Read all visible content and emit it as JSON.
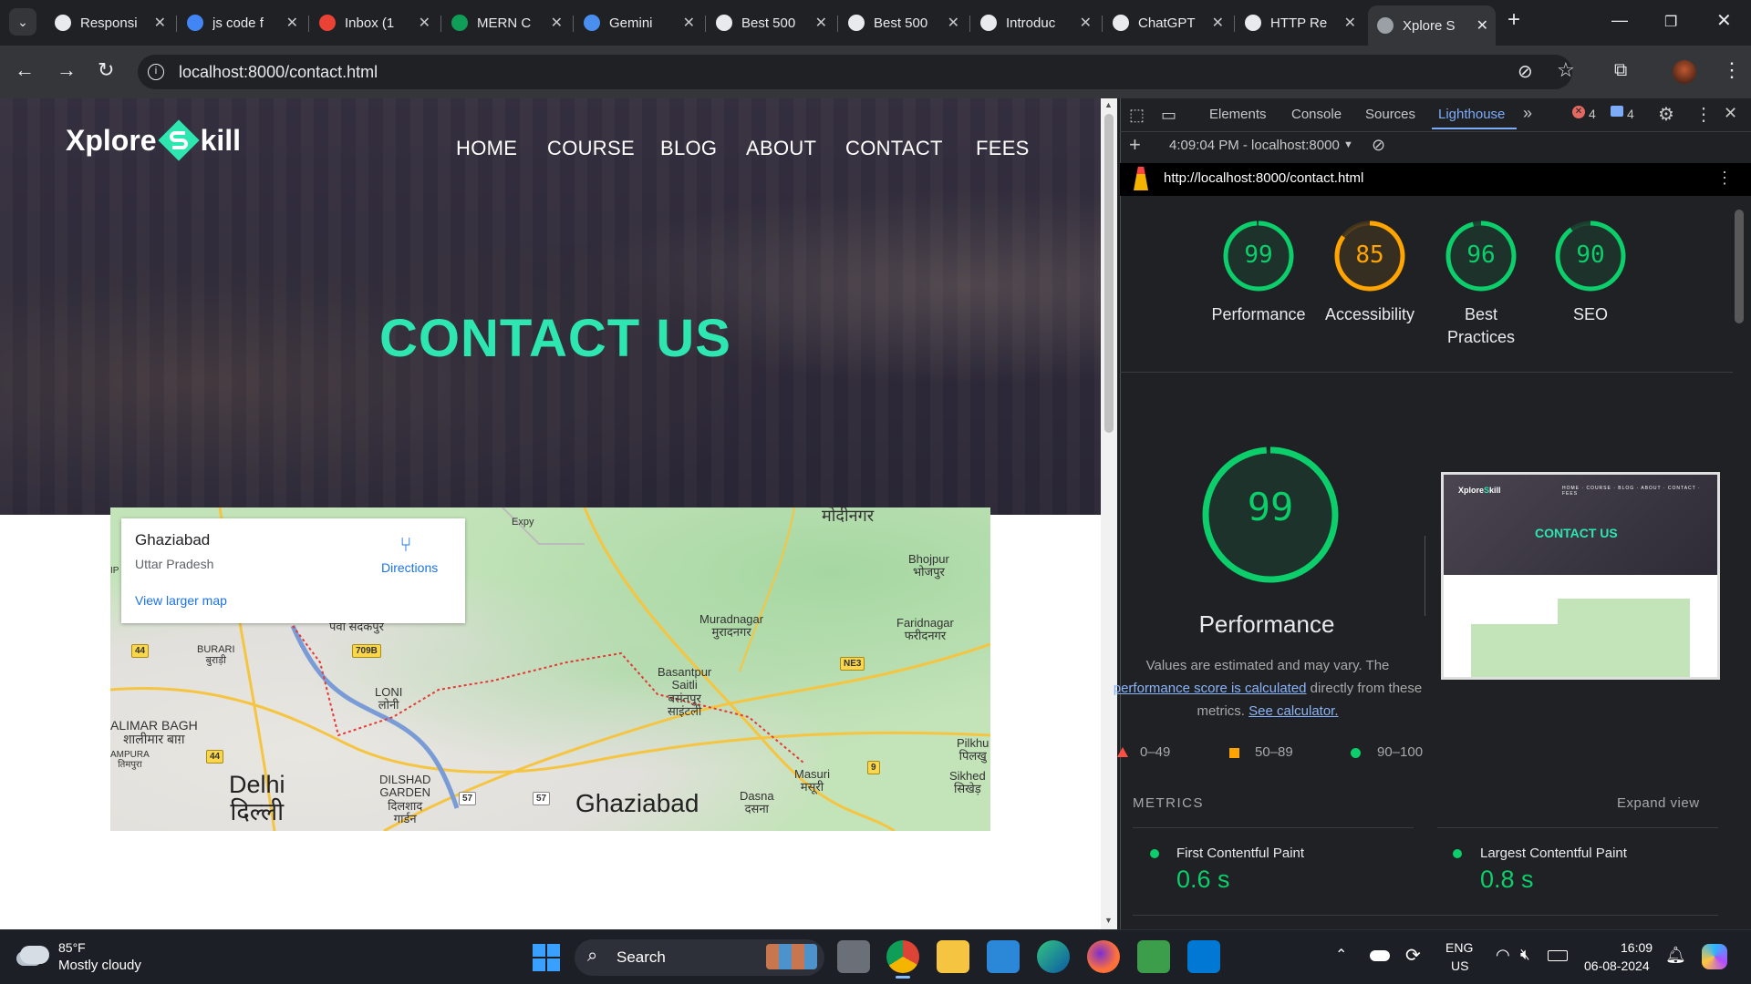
{
  "browser": {
    "tabs": [
      {
        "title": "Responsi",
        "icon": "chatgpt-icon"
      },
      {
        "title": "js code f",
        "icon": "google-icon"
      },
      {
        "title": "Inbox (1",
        "icon": "gmail-icon"
      },
      {
        "title": "MERN C",
        "icon": "sheets-icon"
      },
      {
        "title": "Gemini",
        "icon": "gemini-icon"
      },
      {
        "title": "Best 500",
        "icon": "bookmark-icon"
      },
      {
        "title": "Best 500",
        "icon": "bookmark-icon"
      },
      {
        "title": "Introduc",
        "icon": "github-icon"
      },
      {
        "title": "ChatGPT",
        "icon": "chatgpt-icon"
      },
      {
        "title": "HTTP Re",
        "icon": "chatgpt-icon"
      },
      {
        "title": "Xplore S",
        "icon": "globe-icon",
        "active": true
      }
    ],
    "new_tab": "+",
    "url": "localhost:8000/contact.html"
  },
  "site": {
    "logo_left": "Xplore",
    "logo_right": "kill",
    "nav": [
      "HOME",
      "COURSE",
      "BLOG",
      "ABOUT",
      "CONTACT",
      "FEES"
    ],
    "hero_title": "CONTACT US",
    "accent_color": "#2ee6b0"
  },
  "map": {
    "place": "Ghaziabad",
    "region": "Uttar Pradesh",
    "directions": "Directions",
    "larger_map": "View larger map",
    "labels": [
      {
        "text": "मोदीनगर",
        "name": "map-label-modinagar"
      },
      {
        "text": "Bhojpur\nभोजपुर",
        "name": "map-label-bhojpur"
      },
      {
        "text": "Muradnagar\nमुरादनगर",
        "name": "map-label-muradnagar"
      },
      {
        "text": "Faridnagar\nफरीदनगर",
        "name": "map-label-faridnagar"
      },
      {
        "text": "पवा सदकपुर",
        "name": "map-label-pava"
      },
      {
        "text": "BURARI\nबुराड़ी",
        "name": "map-label-burari"
      },
      {
        "text": "Basantpur\nSaitli\nबसंतपुर\nसाइंटली",
        "name": "map-label-basantpur"
      },
      {
        "text": "LONI\nलोनी",
        "name": "map-label-loni"
      },
      {
        "text": "ALIMAR BAGH\nशालीमार बाग़",
        "name": "map-label-shalimar"
      },
      {
        "text": "AMPURA\nतिमपुरा",
        "name": "map-label-ampura"
      },
      {
        "text": "DILSHAD\nGARDEN\nदिलशाद\nगार्डन",
        "name": "map-label-dilshad"
      },
      {
        "text": "Pilkhu\nपिलखु",
        "name": "map-label-pilkhu"
      },
      {
        "text": "Masuri\nमसूरी",
        "name": "map-label-masuri"
      },
      {
        "text": "Sikhed\nसिखेड़",
        "name": "map-label-sikhed"
      },
      {
        "text": "Dasna\nदसना",
        "name": "map-label-dasna"
      },
      {
        "text": "Delhi\nदिल्ली",
        "name": "map-label-delhi"
      },
      {
        "text": "Ghaziabad",
        "name": "map-label-ghaziabad"
      },
      {
        "text": "IP",
        "name": "map-label-ip"
      },
      {
        "text": "Expy",
        "name": "map-label-expy"
      }
    ],
    "shields": [
      "44",
      "709B",
      "NE3",
      "44",
      "9",
      "57",
      "57"
    ]
  },
  "devtools": {
    "tabs": [
      "Elements",
      "Console",
      "Sources",
      "Lighthouse"
    ],
    "active_tab": "Lighthouse",
    "errors": "4",
    "messages": "4",
    "report_time": "4:09:04 PM - localhost:8000",
    "report_url": "http://localhost:8000/contact.html",
    "scores": [
      {
        "label": "Performance",
        "value": 99,
        "color": "#0cce6b"
      },
      {
        "label": "Accessibility",
        "value": 85,
        "color": "#ffa400"
      },
      {
        "label": "Best Practices",
        "value": 96,
        "color": "#0cce6b"
      },
      {
        "label": "SEO",
        "value": 90,
        "color": "#0cce6b"
      }
    ],
    "main_score": 99,
    "main_title": "Performance",
    "desc_1": "Values are estimated and may vary. The",
    "desc_link": "performance score is calculated",
    "desc_2": " directly from these",
    "desc_3": "metrics. ",
    "desc_calc": "See calculator.",
    "legend": [
      "0–49",
      "50–89",
      "90–100"
    ],
    "metrics_heading": "METRICS",
    "expand": "Expand view",
    "metrics": [
      {
        "name": "First Contentful Paint",
        "value": "0.6 s"
      },
      {
        "name": "Largest Contentful Paint",
        "value": "0.8 s"
      }
    ],
    "thumb_title": "CONTACT US"
  },
  "taskbar": {
    "temp": "85°F",
    "weather": "Mostly cloudy",
    "search": "Search",
    "lang": "ENG",
    "region": "US",
    "time": "16:09",
    "date": "06-08-2024"
  }
}
